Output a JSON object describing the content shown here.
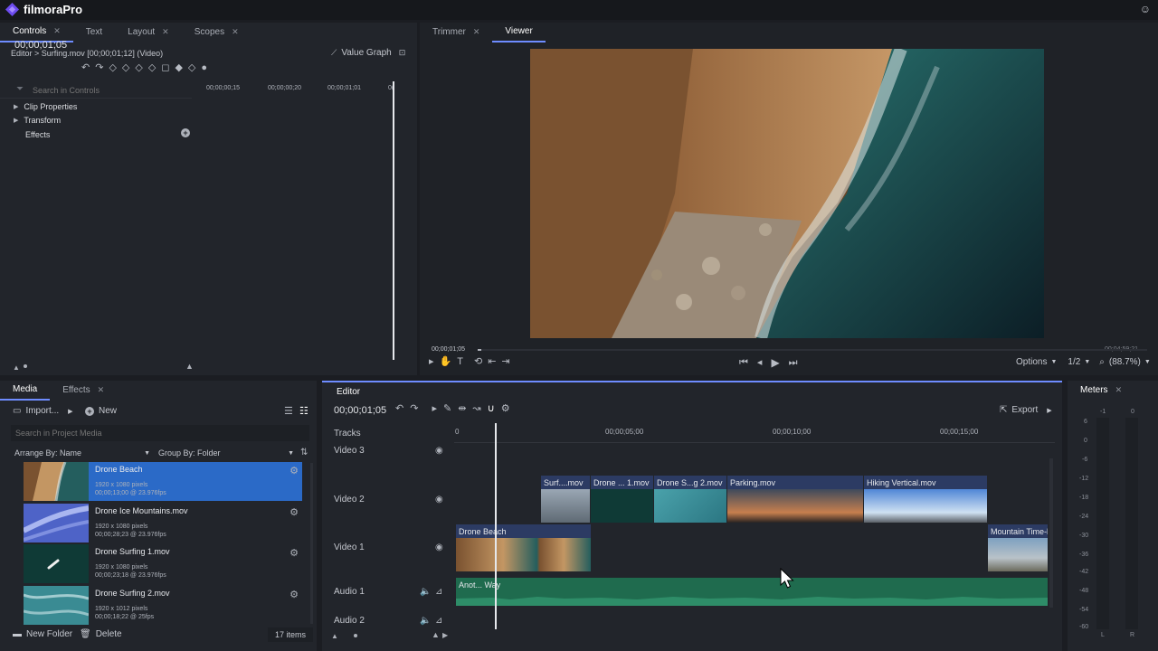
{
  "app": {
    "title": "filmoraPro"
  },
  "controls": {
    "tabs": [
      {
        "label": "Controls",
        "closable": true
      },
      {
        "label": "Text",
        "closable": false
      },
      {
        "label": "Layout",
        "closable": true
      },
      {
        "label": "Scopes",
        "closable": true
      }
    ],
    "breadcrumb": "Editor > Surfing.mov [00;00;01;12] (Video)",
    "timecode": "00;00;01;05",
    "value_graph": "Value Graph",
    "search_placeholder": "Search in Controls",
    "ruler": [
      "00;00;00;15",
      "00;00;00;20",
      "00;00;01;01",
      "0("
    ],
    "tree": [
      {
        "label": "Clip Properties",
        "expandable": true
      },
      {
        "label": "Transform",
        "expandable": true
      },
      {
        "label": "Effects",
        "expandable": false
      }
    ]
  },
  "viewer": {
    "tabs": [
      {
        "label": "Trimmer",
        "closable": true
      },
      {
        "label": "Viewer",
        "closable": false
      }
    ],
    "current_time": "00;00;01;05",
    "duration": "00;04;59;21",
    "progress": 0.005,
    "options_label": "Options",
    "resolution": "1/2",
    "zoom": "(88.7%)"
  },
  "media": {
    "tabs": [
      {
        "label": "Media",
        "closable": false
      },
      {
        "label": "Effects",
        "closable": true
      }
    ],
    "import_label": "Import...",
    "new_label": "New",
    "search_placeholder": "Search in Project Media",
    "arrange_label": "Arrange By: Name",
    "group_label": "Group By: Folder",
    "items": [
      {
        "name": "Drone Beach",
        "res": "1920 x 1080 pixels",
        "dur": "00;00;13;00 @ 23.976fps",
        "selected": true
      },
      {
        "name": "Drone Ice Mountains.mov",
        "res": "1920 x 1080 pixels",
        "dur": "00;00;28;23 @ 23.976fps",
        "selected": false
      },
      {
        "name": "Drone Surfing 1.mov",
        "res": "1920 x 1080 pixels",
        "dur": "00;00;23;18 @ 23.976fps",
        "selected": false
      },
      {
        "name": "Drone Surfing 2.mov",
        "res": "1920 x 1012 pixels",
        "dur": "00;00;18;22 @ 25fps",
        "selected": false
      }
    ],
    "new_folder_label": "New Folder",
    "delete_label": "Delete",
    "count": "17 items"
  },
  "editor": {
    "tab": "Editor",
    "timecode": "00;00;01;05",
    "export_label": "Export",
    "tracks_label": "Tracks",
    "ruler": [
      "0",
      "00;00;05;00",
      "00;00;10;00",
      "00;00;15;00"
    ],
    "tracks": [
      "Video 3",
      "Video 2",
      "Video 1",
      "Audio 1",
      "Audio 2"
    ],
    "clips_v2": [
      "Surf....mov",
      "Drone ... 1.mov",
      "Drone S...g 2.mov",
      "Parking.mov",
      "Hiking Vertical.mov"
    ],
    "clips_v1": [
      "Drone Beach",
      "Mountain Time-l"
    ],
    "clip_a1": "Anot... Way"
  },
  "meters": {
    "title": "Meters",
    "top": [
      "-1",
      "0"
    ],
    "scale": [
      "6",
      "0",
      "-6",
      "-12",
      "-18",
      "-24",
      "-30",
      "-36",
      "-42",
      "-48",
      "-54",
      "-60"
    ],
    "channels": [
      "L",
      "R"
    ]
  }
}
